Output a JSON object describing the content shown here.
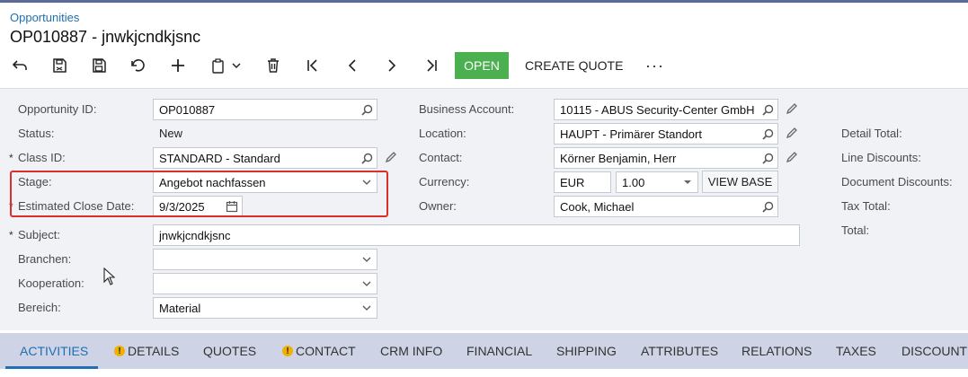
{
  "breadcrumb": "Opportunities",
  "title": "OP010887 - jnwkjcndkjsnc",
  "toolbar": {
    "icons": [
      "back-icon",
      "save-close-icon",
      "save-icon",
      "undo-icon",
      "add-icon",
      "copy-paste-icon",
      "delete-icon",
      "first-icon",
      "prev-icon",
      "next-icon",
      "last-icon"
    ],
    "open_label": "OPEN",
    "create_quote_label": "CREATE QUOTE",
    "more_label": "···"
  },
  "colors": {
    "accent": "#1f6fb2",
    "open_button": "#4caf50",
    "highlight": "#d9302b",
    "tabs_bg": "#ced3e6"
  },
  "form": {
    "labels": {
      "opportunity_id": "Opportunity ID:",
      "status": "Status:",
      "class_id": "Class ID:",
      "stage": "Stage:",
      "close_date": "Estimated Close Date:",
      "subject": "Subject:",
      "branchen": "Branchen:",
      "kooperation": "Kooperation:",
      "bereich": "Bereich:",
      "business_account": "Business Account:",
      "location": "Location:",
      "contact": "Contact:",
      "currency": "Currency:",
      "owner": "Owner:",
      "detail_total": "Detail Total:",
      "line_discounts": "Line Discounts:",
      "document_discounts": "Document Discounts:",
      "tax_total": "Tax Total:",
      "total": "Total:"
    },
    "required_marker": "*",
    "values": {
      "opportunity_id": "OP010887",
      "status": "New",
      "class_id": "STANDARD - Standard",
      "stage": "Angebot nachfassen",
      "close_date": "9/3/2025",
      "subject": "jnwkjcndkjsnc",
      "branchen": "",
      "kooperation": "",
      "bereich": "Material",
      "business_account": "10115 - ABUS Security-Center GmbH",
      "location": "HAUPT - Primärer Standort",
      "contact": "Körner Benjamin, Herr",
      "currency": "EUR",
      "rate": "1.00",
      "owner": "Cook, Michael"
    },
    "view_base_label": "VIEW BASE"
  },
  "tabs": [
    {
      "label": "ACTIVITIES",
      "warning": false,
      "active": true
    },
    {
      "label": "DETAILS",
      "warning": true,
      "active": false
    },
    {
      "label": "QUOTES",
      "warning": false,
      "active": false
    },
    {
      "label": "CONTACT",
      "warning": true,
      "active": false
    },
    {
      "label": "CRM INFO",
      "warning": false,
      "active": false
    },
    {
      "label": "FINANCIAL",
      "warning": false,
      "active": false
    },
    {
      "label": "SHIPPING",
      "warning": false,
      "active": false
    },
    {
      "label": "ATTRIBUTES",
      "warning": false,
      "active": false
    },
    {
      "label": "RELATIONS",
      "warning": false,
      "active": false
    },
    {
      "label": "TAXES",
      "warning": false,
      "active": false
    },
    {
      "label": "DISCOUNTS",
      "warning": false,
      "active": false
    }
  ],
  "warning_glyph": "!"
}
